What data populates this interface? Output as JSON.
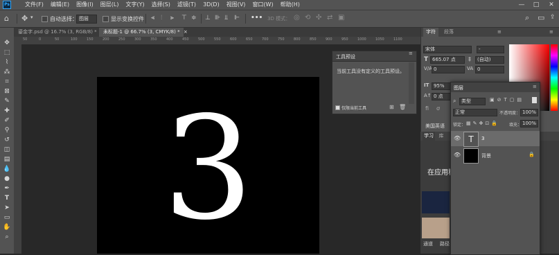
{
  "menubar": {
    "app_icon": "Ps",
    "items": [
      "文件(F)",
      "编辑(E)",
      "图像(I)",
      "图层(L)",
      "文字(Y)",
      "选择(S)",
      "滤镜(T)",
      "3D(D)",
      "视图(V)",
      "窗口(W)",
      "帮助(H)"
    ],
    "window_controls": [
      "—",
      "□",
      "✕"
    ]
  },
  "optionsbar": {
    "auto_select_label": "自动选择：",
    "auto_select_target": "图层",
    "show_transform_label": "显示变换控件",
    "mode_3d_label": "3D 模式：",
    "more_label": "•••"
  },
  "tabs": [
    {
      "label": "鎏金字.psd @ 16.7% (3, RGB/8) *",
      "close": "×"
    },
    {
      "label": "未标题-1 @ 66.7% (3, CMYK/8) *",
      "close": "×"
    }
  ],
  "ruler": {
    "marks": [
      "50",
      "0",
      "50",
      "100",
      "150",
      "200",
      "250",
      "300",
      "350",
      "400",
      "450",
      "500",
      "550",
      "600",
      "650",
      "700",
      "750",
      "800",
      "850",
      "900",
      "950",
      "1000",
      "1050",
      "1100"
    ]
  },
  "canvas": {
    "text": "3"
  },
  "tool_presets": {
    "title": "工具预设",
    "message": "当前工具没有定义的工具预设。",
    "current_tool_only": "仅限当前工具"
  },
  "character": {
    "tabs": [
      "字符",
      "段落"
    ],
    "font_family": "宋体",
    "font_style": "-",
    "font_size": "665.07 点",
    "leading": "(自动)",
    "kerning": "0",
    "tracking": "0",
    "vscale": "95%",
    "baseline": "0 点",
    "language": "美国英语"
  },
  "layers": {
    "title": "图层",
    "kind": "类型",
    "blend_mode": "正常",
    "opacity_label": "不透明度：",
    "opacity": "100%",
    "lock_label": "锁定：",
    "fill_label": "填充：",
    "fill": "100%",
    "rows": [
      {
        "name": "3",
        "thumb": "T"
      },
      {
        "name": "背景",
        "thumb": ""
      }
    ]
  },
  "learn": {
    "tabs": [
      "学习",
      "库"
    ],
    "heading": "在应用程",
    "bottom_tabs": [
      "通道",
      "路径"
    ]
  },
  "colors": {
    "accent": "#31a8ff",
    "canvas": "#000000",
    "panel": "#535353"
  }
}
